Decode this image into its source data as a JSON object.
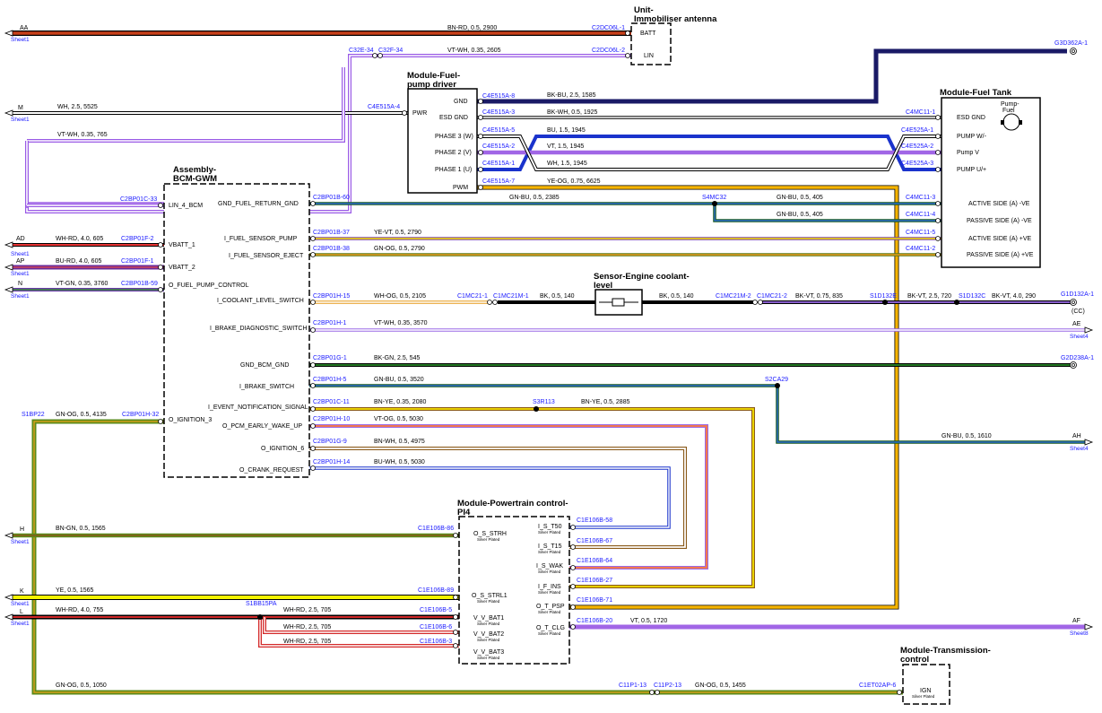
{
  "modules": {
    "immobiliser": {
      "title1": "Unit-",
      "title2": "Immobiliser antenna",
      "pins": [
        "BATT",
        "LIN"
      ]
    },
    "fuelpump_driver": {
      "title1": "Module-Fuel-",
      "title2": "pump driver",
      "pwr": "PWR",
      "pins": [
        "GND",
        "ESD GND",
        "PHASE 3 (W)",
        "PHASE 2 (V)",
        "PHASE 1 (U)",
        "PWM"
      ]
    },
    "fuel_tank": {
      "title": "Module-Fuel Tank",
      "pump1": "Pump-",
      "pump2": "Fuel",
      "pins": [
        "ESD GND",
        "PUMP W/-",
        "Pump V",
        "PUMP U/+",
        "ACTIVE SIDE (A) -VE",
        "PASSIVE SIDE (A) -VE",
        "ACTIVE SIDE (A) +VE",
        "PASSIVE SIDE (A) +VE"
      ]
    },
    "bcm": {
      "title1": "Assembly-",
      "title2": "BCM-GWM",
      "pins": [
        "LIN_4_BCM",
        "GND_FUEL_RETURN_GND",
        "VBATT_1",
        "I_FUEL_SENSOR_PUMP",
        "VBATT_2",
        "I_FUEL_SENSOR_EJECT",
        "O_FUEL_PUMP_CONTROL",
        "I_COOLANT_LEVEL_SWITCH",
        "I_BRAKE_DIAGNOSTIC_SWITCH",
        "GND_BCM_GND",
        "I_BRAKE_SWITCH",
        "I_EVENT_NOTIFICATION_SIGNAL",
        "O_IGNITION_3",
        "O_PCM_EARLY_WAKE_UP",
        "O_IGNITION_6",
        "O_CRANK_REQUEST"
      ]
    },
    "sensor": {
      "title1": "Sensor-Engine coolant-",
      "title2": "level"
    },
    "pcm": {
      "title1": "Module-Powertrain control-",
      "title2": "PI4",
      "left_pins": [
        "O_S_STRH",
        "O_S_STRL1",
        "V_V_BAT1",
        "V_V_BAT2",
        "V_V_BAT3"
      ],
      "right_pins": [
        "I_S_T50",
        "I_S_T15",
        "I_S_WAK",
        "I_F_INS",
        "O_T_PSP",
        "O_T_CLG"
      ],
      "plating": "Silver Plated"
    },
    "tcm": {
      "title1": "Module-Transmission-",
      "title2": "control",
      "pin": "IGN"
    }
  },
  "connectors": {
    "aa_right": "C2DC06L-1",
    "lin_right": "C2DC06L-2",
    "c32e": "C32E-34",
    "c32f": "C32F-34",
    "m_pwr": "C4E515A-4",
    "gnd": "C4E515A-8",
    "esd": "C4E515A-3",
    "ph3": "C4E515A-5",
    "ph2": "C4E515A-2",
    "ph1": "C4E515A-1",
    "pwm": "C4E515A-7",
    "tank_esd": "C4MC11-1",
    "tank_w": "C4E525A-1",
    "tank_v": "C4E525A-2",
    "tank_u": "C4E525A-3",
    "tank_3": "C4MC11-3",
    "tank_4": "C4MC11-4",
    "tank_5": "C4MC11-5",
    "tank_2": "C4MC11-2",
    "g3d": "G3D362A-1",
    "bcm_lin": "C2BP01C-33",
    "bcm_60": "C2BP01B-60",
    "bcm_37": "C2BP01B-37",
    "bcm_38": "C2BP01B-38",
    "bcm_f2": "C2BP01F-2",
    "bcm_f1": "C2BP01F-1",
    "bcm_59": "C2BP01B-59",
    "s4mc": "S4MC32",
    "h15": "C2BP01H-15",
    "c1mc21_1": "C1MC21-1",
    "c1mc21m_1": "C1MC21M-1",
    "c1mc21m_2": "C1MC21M-2",
    "c1mc21_2": "C1MC21-2",
    "s1d132e": "S1D132E",
    "s1d132c": "S1D132C",
    "g1d132": "G1D132A-1",
    "cc": "(CC)",
    "h1": "C2BP01H-1",
    "g1": "C2BP01G-1",
    "g2d": "G2D238A-1",
    "h5": "C2BP01H-5",
    "s2ca": "S2CA29",
    "c11": "C2BP01C-11",
    "s3r": "S3R113",
    "h32": "C2BP01H-32",
    "s1bp": "S1BP22",
    "h10": "C2BP01H-10",
    "g9": "C2BP01G-9",
    "h14": "C2BP01H-14",
    "e58": "C1E106B-58",
    "e67": "C1E106B-67",
    "e64": "C1E106B-64",
    "e27": "C1E106B-27",
    "e71": "C1E106B-71",
    "e20": "C1E106B-20",
    "e86": "C1E106B-86",
    "e89": "C1E106B-89",
    "e5": "C1E106B-5",
    "e6": "C1E106B-6",
    "e3": "C1E106B-3",
    "s1bb": "S1BB15PA",
    "c11p1": "C11P1-13",
    "c11p2": "C11P2-13",
    "c1et": "C1ET02AP-6"
  },
  "wires": {
    "aa": "BN-RD,  0.5,  2900",
    "lin": "VT-WH,  0.35,  2605",
    "m": "WH,  2.5,  5525",
    "vtwh765": "VT-WH,  0.35,  765",
    "gnd": "BK-BU,  2.5,  1585",
    "esd": "BK-WH,  0.5,  1925",
    "ph3": "BU,  1.5,  1945",
    "ph2": "VT,  1.5,  1945",
    "ph1": "WH,  1.5,  1945",
    "pwm": "YE-OG,  0.75,  6625",
    "gnbu2385": "GN-BU,  0.5,  2385",
    "gnbu405a": "GN-BU,  0.5,  405",
    "gnbu405b": "GN-BU,  0.5,  405",
    "ad": "WH-RD,  4.0,  605",
    "ap": "BU-RD,  4.0,  605",
    "n": "VT-GN,  0.35,  3760",
    "yevt": "YE-VT,  0.5,  2790",
    "gnog2790": "GN-OG,  0.5,  2790",
    "whog": "WH-OG,  0.5,  2105",
    "bk140a": "BK,  0.5,  140",
    "bk140b": "BK,  0.5,  140",
    "bkvt835": "BK-VT,  0.75,  835",
    "bkvt720": "BK-VT,  2.5,  720",
    "bkvt290": "BK-VT,  4.0,  290",
    "vtwh3570": "VT-WH,  0.35,  3570",
    "bkgn": "BK-GN,  2.5,  545",
    "gnbu3520": "GN-BU,  0.5,  3520",
    "gnbu1610": "GN-BU,  0.5,  1610",
    "bnye2080": "BN-YE,  0.35,  2080",
    "bnye2885": "BN-YE,  0.5,  2885",
    "gnog4135": "GN-OG,  0.5,  4135",
    "vtog": "VT-OG,  0.5,  5030",
    "bnwh": "BN-WH,  0.5,  4975",
    "buwh": "BU-WH,  0.5,  5030",
    "h": "BN-GN,  0.5,  1565",
    "k": "YE,  0.5,  1565",
    "l": "WH-RD,  4.0,  755",
    "whrd1": "WH-RD,  2.5,  705",
    "whrd2": "WH-RD,  2.5,  705",
    "whrd3": "WH-RD,  2.5,  705",
    "vt1720": "VT,  0.5,  1720",
    "gnog1050": "GN-OG,  0.5,  1050",
    "gnog1455": "GN-OG,  0.5,  1455"
  },
  "offsheet": {
    "aa": "AA",
    "m": "M",
    "ad": "AD",
    "ap": "AP",
    "n": "N",
    "h": "H",
    "k": "K",
    "l": "L",
    "ae": "AE",
    "ah": "AH",
    "af": "AF",
    "sheet1": "Sheet1",
    "sheet4": "Sheet4",
    "sheet8": "Sheet8"
  }
}
